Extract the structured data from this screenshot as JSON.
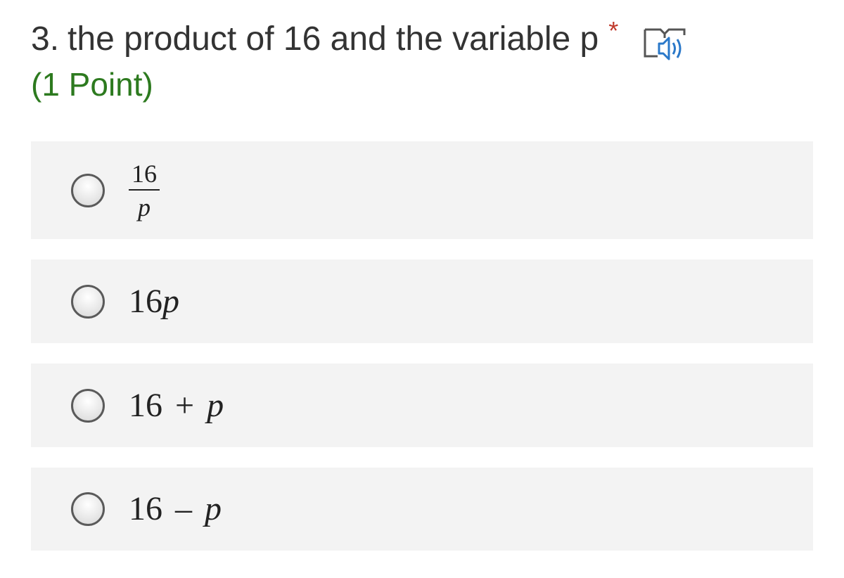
{
  "question": {
    "number": "3.",
    "text": "the product of 16 and the variable p",
    "required_marker": "*",
    "points": "(1 Point)",
    "reader_icon": "immersive-reader-icon"
  },
  "options": [
    {
      "type": "fraction",
      "numerator": "16",
      "denominator": "p"
    },
    {
      "type": "product",
      "coefficient": "16",
      "variable": "p"
    },
    {
      "type": "expression",
      "left": "16",
      "operator": "+",
      "right": "p"
    },
    {
      "type": "expression",
      "left": "16",
      "operator": "–",
      "right": "p"
    }
  ],
  "colors": {
    "required_star": "#c0392b",
    "points_text": "#2d7a1f",
    "option_background": "#f3f3f3",
    "reader_icon": "#2a78c9"
  }
}
